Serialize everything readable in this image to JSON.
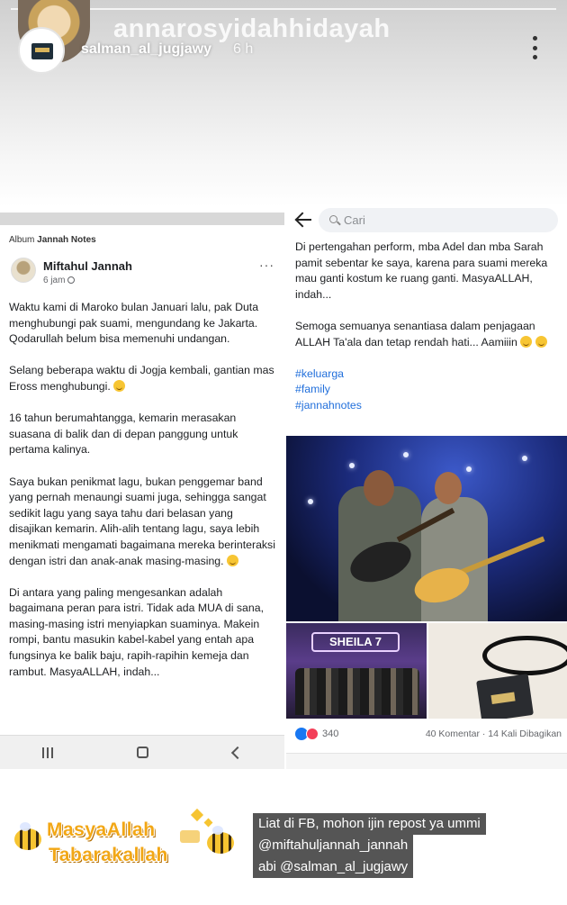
{
  "story": {
    "background_username": "annarosyidahhidayah",
    "username": "salman_al_jugjawy",
    "time": "6 h",
    "segments": 1
  },
  "left_post": {
    "album_prefix": "Album",
    "album_name": "Jannah Notes",
    "author": "Miftahul Jannah",
    "time": "6 jam",
    "more": "···",
    "paragraphs": [
      "Waktu kami di Maroko bulan Januari lalu, pak Duta menghubungi pak suami, mengundang ke Jakarta. Qodarullah belum bisa memenuhi undangan.",
      "Selang beberapa waktu di Jogja kembali, gantian mas Eross menghubungi.",
      "16 tahun berumahtangga, kemarin merasakan suasana di balik dan di depan panggung untuk pertama kalinya.",
      "Saya bukan penikmat lagu, bukan penggemar band yang pernah menaungi suami juga, sehingga sangat sedikit lagu yang saya tahu dari belasan yang disajikan kemarin. Alih-alih tentang lagu, saya lebih menikmati mengamati bagaimana mereka berinteraksi dengan istri dan anak-anak masing-masing.",
      "Di antara yang paling mengesankan adalah bagaimana peran para istri. Tidak ada MUA di sana, masing-masing istri menyiapkan suaminya. Makein rompi, bantu masukin kabel-kabel yang entah apa fungsinya ke balik baju, rapih-rapihin kemeja dan rambut. MasyaALLAH, indah..."
    ],
    "nav": [
      "III",
      "◻",
      "<"
    ]
  },
  "right_post": {
    "search_placeholder": "Cari",
    "paragraph1": "Di pertengahan perform, mba Adel dan mba Sarah pamit sebentar ke saya, karena para suami mereka mau ganti kostum ke ruang ganti. MasyaALLAH, indah...",
    "paragraph2": "Semoga semuanya senantiasa dalam penjagaan ALLAH Ta'ala dan tetap rendah hati... Aamiiin",
    "hashtags": [
      "#keluarga",
      "#family",
      "#jannahnotes"
    ],
    "stage_sign": "SHEILA 7",
    "reaction_count": "340",
    "counts": "40 Komentar · 14 Kali Dibagikan"
  },
  "sticker": {
    "line1": "MasyaAllah",
    "line2": "Tabarakallah",
    "jar_label": "MADU"
  },
  "caption": {
    "lines": [
      "Liat di FB, mohon ijin repost ya ummi",
      "@miftahuljannah_jannah",
      "abi @salman_al_jugjawy"
    ]
  },
  "colors": {
    "hashtag": "#216fdb",
    "sticker_text": "#f2a716",
    "caption_bg": "#464646"
  }
}
